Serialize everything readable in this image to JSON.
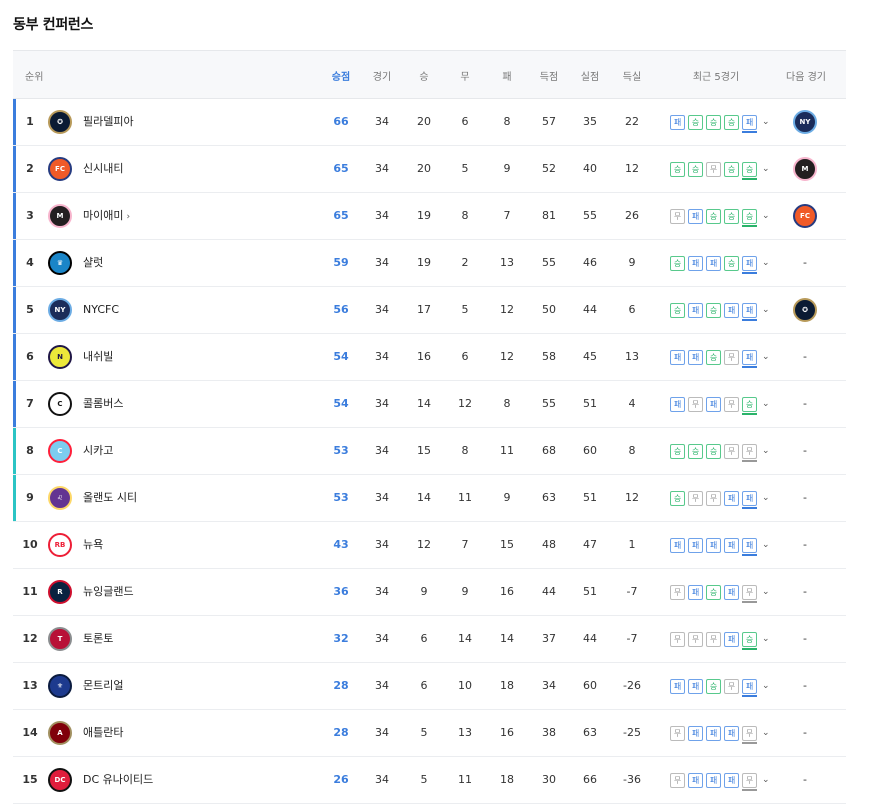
{
  "title": "동부 컨퍼런스",
  "headers": {
    "rank": "순위",
    "pts": "승점",
    "gp": "경기",
    "w": "승",
    "d": "무",
    "l": "패",
    "gf": "득점",
    "ga": "실점",
    "gd": "득실",
    "recent": "최근 5경기",
    "next": "다음 경기"
  },
  "result_labels": {
    "W": "승",
    "D": "무",
    "L": "패"
  },
  "colors": {
    "accent": "#3b7ddd",
    "bar_blue": "#3b7ddd",
    "bar_teal": "#2bc4c4",
    "win": "#2ab36a",
    "loss": "#3b7ddd",
    "draw": "#999999"
  },
  "rows": [
    {
      "rank": "1",
      "team": "필라델피아",
      "pts": "66",
      "gp": "34",
      "w": "20",
      "d": "6",
      "l": "8",
      "gf": "57",
      "ga": "35",
      "gd": "22",
      "recent": [
        "L",
        "W",
        "W",
        "W",
        "L"
      ],
      "next": "nycfc",
      "logo": "philadelphia-union-logo",
      "bar": "blue"
    },
    {
      "rank": "2",
      "team": "신시내티",
      "pts": "65",
      "gp": "34",
      "w": "20",
      "d": "5",
      "l": "9",
      "gf": "52",
      "ga": "40",
      "gd": "12",
      "recent": [
        "W",
        "W",
        "D",
        "W",
        "W"
      ],
      "next": "miami",
      "logo": "fc-cincinnati-logo",
      "bar": "blue"
    },
    {
      "rank": "3",
      "team": "마이애미",
      "pts": "65",
      "gp": "34",
      "w": "19",
      "d": "8",
      "l": "7",
      "gf": "81",
      "ga": "55",
      "gd": "26",
      "recent": [
        "D",
        "L",
        "W",
        "W",
        "W"
      ],
      "next": "cincinnati",
      "logo": "inter-miami-logo",
      "bar": "blue",
      "chevron": "›"
    },
    {
      "rank": "4",
      "team": "샬럿",
      "pts": "59",
      "gp": "34",
      "w": "19",
      "d": "2",
      "l": "13",
      "gf": "55",
      "ga": "46",
      "gd": "9",
      "recent": [
        "W",
        "L",
        "L",
        "W",
        "L"
      ],
      "next": "-",
      "logo": "charlotte-fc-logo",
      "bar": "blue"
    },
    {
      "rank": "5",
      "team": "NYCFC",
      "pts": "56",
      "gp": "34",
      "w": "17",
      "d": "5",
      "l": "12",
      "gf": "50",
      "ga": "44",
      "gd": "6",
      "recent": [
        "W",
        "L",
        "W",
        "L",
        "L"
      ],
      "next": "philadelphia",
      "logo": "nycfc-logo",
      "bar": "blue"
    },
    {
      "rank": "6",
      "team": "내쉬빌",
      "pts": "54",
      "gp": "34",
      "w": "16",
      "d": "6",
      "l": "12",
      "gf": "58",
      "ga": "45",
      "gd": "13",
      "recent": [
        "L",
        "L",
        "W",
        "D",
        "L"
      ],
      "next": "-",
      "logo": "nashville-sc-logo",
      "bar": "blue"
    },
    {
      "rank": "7",
      "team": "콜롬버스",
      "pts": "54",
      "gp": "34",
      "w": "14",
      "d": "12",
      "l": "8",
      "gf": "55",
      "ga": "51",
      "gd": "4",
      "recent": [
        "L",
        "D",
        "L",
        "D",
        "W"
      ],
      "next": "-",
      "logo": "columbus-crew-logo",
      "bar": "blue"
    },
    {
      "rank": "8",
      "team": "시카고",
      "pts": "53",
      "gp": "34",
      "w": "15",
      "d": "8",
      "l": "11",
      "gf": "68",
      "ga": "60",
      "gd": "8",
      "recent": [
        "W",
        "W",
        "W",
        "D",
        "D"
      ],
      "next": "-",
      "logo": "chicago-fire-logo",
      "bar": "teal"
    },
    {
      "rank": "9",
      "team": "올랜도 시티",
      "pts": "53",
      "gp": "34",
      "w": "14",
      "d": "11",
      "l": "9",
      "gf": "63",
      "ga": "51",
      "gd": "12",
      "recent": [
        "W",
        "D",
        "D",
        "L",
        "L"
      ],
      "next": "-",
      "logo": "orlando-city-logo",
      "bar": "teal"
    },
    {
      "rank": "10",
      "team": "뉴욕",
      "pts": "43",
      "gp": "34",
      "w": "12",
      "d": "7",
      "l": "15",
      "gf": "48",
      "ga": "47",
      "gd": "1",
      "recent": [
        "L",
        "L",
        "L",
        "L",
        "L"
      ],
      "next": "-",
      "logo": "ny-red-bulls-logo",
      "bar": "none"
    },
    {
      "rank": "11",
      "team": "뉴잉글랜드",
      "pts": "36",
      "gp": "34",
      "w": "9",
      "d": "9",
      "l": "16",
      "gf": "44",
      "ga": "51",
      "gd": "-7",
      "recent": [
        "D",
        "L",
        "W",
        "L",
        "D"
      ],
      "next": "-",
      "logo": "new-england-revolution-logo",
      "bar": "none"
    },
    {
      "rank": "12",
      "team": "토론토",
      "pts": "32",
      "gp": "34",
      "w": "6",
      "d": "14",
      "l": "14",
      "gf": "37",
      "ga": "44",
      "gd": "-7",
      "recent": [
        "D",
        "D",
        "D",
        "L",
        "W"
      ],
      "next": "-",
      "logo": "toronto-fc-logo",
      "bar": "none"
    },
    {
      "rank": "13",
      "team": "몬트리얼",
      "pts": "28",
      "gp": "34",
      "w": "6",
      "d": "10",
      "l": "18",
      "gf": "34",
      "ga": "60",
      "gd": "-26",
      "recent": [
        "L",
        "L",
        "W",
        "D",
        "L"
      ],
      "next": "-",
      "logo": "cf-montreal-logo",
      "bar": "none"
    },
    {
      "rank": "14",
      "team": "애틀란타",
      "pts": "28",
      "gp": "34",
      "w": "5",
      "d": "13",
      "l": "16",
      "gf": "38",
      "ga": "63",
      "gd": "-25",
      "recent": [
        "D",
        "L",
        "L",
        "L",
        "D"
      ],
      "next": "-",
      "logo": "atlanta-united-logo",
      "bar": "none"
    },
    {
      "rank": "15",
      "team": "DC 유나이티드",
      "pts": "26",
      "gp": "34",
      "w": "5",
      "d": "11",
      "l": "18",
      "gf": "30",
      "ga": "66",
      "gd": "-36",
      "recent": [
        "D",
        "L",
        "L",
        "L",
        "D"
      ],
      "next": "-",
      "logo": "dc-united-logo",
      "bar": "none"
    }
  ]
}
